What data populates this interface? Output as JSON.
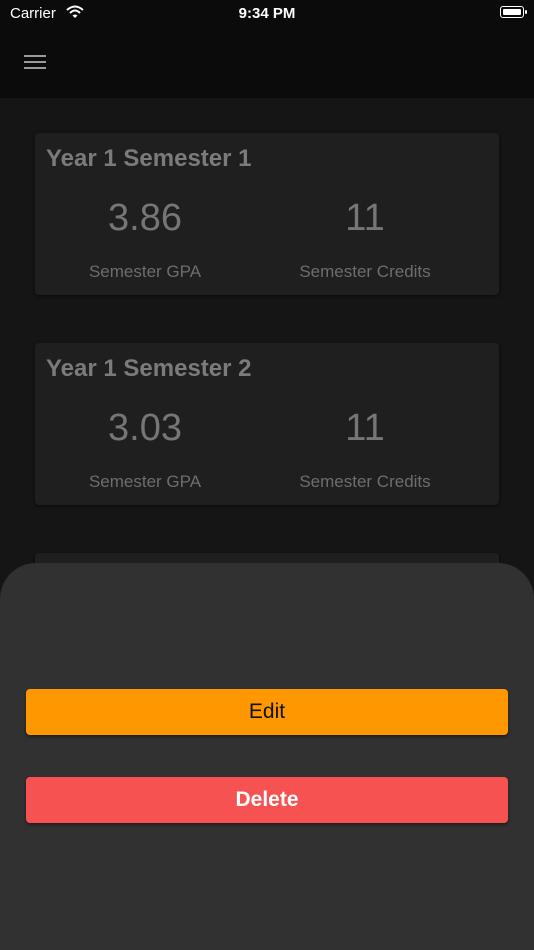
{
  "status_bar": {
    "carrier": "Carrier",
    "time": "9:34 PM"
  },
  "app_bar": {
    "menu_icon": "hamburger-menu-icon"
  },
  "semesters": [
    {
      "title": "Year 1 Semester 1",
      "gpa": "3.86",
      "gpa_label": "Semester GPA",
      "credits": "11",
      "credits_label": "Semester Credits"
    },
    {
      "title": "Year 1 Semester 2",
      "gpa": "3.03",
      "gpa_label": "Semester GPA",
      "credits": "11",
      "credits_label": "Semester Credits"
    }
  ],
  "bottom_sheet": {
    "edit_label": "Edit",
    "delete_label": "Delete"
  },
  "colors": {
    "edit_button": "#ff9800",
    "delete_button": "#f65252",
    "sheet_bg": "#313131",
    "card_bg": "#1f1f1f"
  }
}
